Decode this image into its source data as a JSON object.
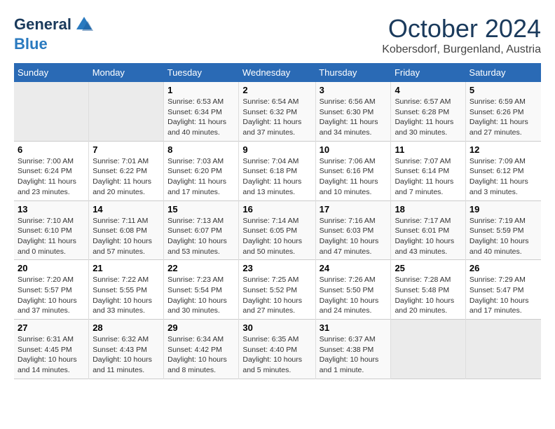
{
  "header": {
    "logo_line1": "General",
    "logo_line2": "Blue",
    "month": "October 2024",
    "location": "Kobersdorf, Burgenland, Austria"
  },
  "weekdays": [
    "Sunday",
    "Monday",
    "Tuesday",
    "Wednesday",
    "Thursday",
    "Friday",
    "Saturday"
  ],
  "weeks": [
    [
      {
        "day": "",
        "info": ""
      },
      {
        "day": "",
        "info": ""
      },
      {
        "day": "1",
        "info": "Sunrise: 6:53 AM\nSunset: 6:34 PM\nDaylight: 11 hours and 40 minutes."
      },
      {
        "day": "2",
        "info": "Sunrise: 6:54 AM\nSunset: 6:32 PM\nDaylight: 11 hours and 37 minutes."
      },
      {
        "day": "3",
        "info": "Sunrise: 6:56 AM\nSunset: 6:30 PM\nDaylight: 11 hours and 34 minutes."
      },
      {
        "day": "4",
        "info": "Sunrise: 6:57 AM\nSunset: 6:28 PM\nDaylight: 11 hours and 30 minutes."
      },
      {
        "day": "5",
        "info": "Sunrise: 6:59 AM\nSunset: 6:26 PM\nDaylight: 11 hours and 27 minutes."
      }
    ],
    [
      {
        "day": "6",
        "info": "Sunrise: 7:00 AM\nSunset: 6:24 PM\nDaylight: 11 hours and 23 minutes."
      },
      {
        "day": "7",
        "info": "Sunrise: 7:01 AM\nSunset: 6:22 PM\nDaylight: 11 hours and 20 minutes."
      },
      {
        "day": "8",
        "info": "Sunrise: 7:03 AM\nSunset: 6:20 PM\nDaylight: 11 hours and 17 minutes."
      },
      {
        "day": "9",
        "info": "Sunrise: 7:04 AM\nSunset: 6:18 PM\nDaylight: 11 hours and 13 minutes."
      },
      {
        "day": "10",
        "info": "Sunrise: 7:06 AM\nSunset: 6:16 PM\nDaylight: 11 hours and 10 minutes."
      },
      {
        "day": "11",
        "info": "Sunrise: 7:07 AM\nSunset: 6:14 PM\nDaylight: 11 hours and 7 minutes."
      },
      {
        "day": "12",
        "info": "Sunrise: 7:09 AM\nSunset: 6:12 PM\nDaylight: 11 hours and 3 minutes."
      }
    ],
    [
      {
        "day": "13",
        "info": "Sunrise: 7:10 AM\nSunset: 6:10 PM\nDaylight: 11 hours and 0 minutes."
      },
      {
        "day": "14",
        "info": "Sunrise: 7:11 AM\nSunset: 6:08 PM\nDaylight: 10 hours and 57 minutes."
      },
      {
        "day": "15",
        "info": "Sunrise: 7:13 AM\nSunset: 6:07 PM\nDaylight: 10 hours and 53 minutes."
      },
      {
        "day": "16",
        "info": "Sunrise: 7:14 AM\nSunset: 6:05 PM\nDaylight: 10 hours and 50 minutes."
      },
      {
        "day": "17",
        "info": "Sunrise: 7:16 AM\nSunset: 6:03 PM\nDaylight: 10 hours and 47 minutes."
      },
      {
        "day": "18",
        "info": "Sunrise: 7:17 AM\nSunset: 6:01 PM\nDaylight: 10 hours and 43 minutes."
      },
      {
        "day": "19",
        "info": "Sunrise: 7:19 AM\nSunset: 5:59 PM\nDaylight: 10 hours and 40 minutes."
      }
    ],
    [
      {
        "day": "20",
        "info": "Sunrise: 7:20 AM\nSunset: 5:57 PM\nDaylight: 10 hours and 37 minutes."
      },
      {
        "day": "21",
        "info": "Sunrise: 7:22 AM\nSunset: 5:55 PM\nDaylight: 10 hours and 33 minutes."
      },
      {
        "day": "22",
        "info": "Sunrise: 7:23 AM\nSunset: 5:54 PM\nDaylight: 10 hours and 30 minutes."
      },
      {
        "day": "23",
        "info": "Sunrise: 7:25 AM\nSunset: 5:52 PM\nDaylight: 10 hours and 27 minutes."
      },
      {
        "day": "24",
        "info": "Sunrise: 7:26 AM\nSunset: 5:50 PM\nDaylight: 10 hours and 24 minutes."
      },
      {
        "day": "25",
        "info": "Sunrise: 7:28 AM\nSunset: 5:48 PM\nDaylight: 10 hours and 20 minutes."
      },
      {
        "day": "26",
        "info": "Sunrise: 7:29 AM\nSunset: 5:47 PM\nDaylight: 10 hours and 17 minutes."
      }
    ],
    [
      {
        "day": "27",
        "info": "Sunrise: 6:31 AM\nSunset: 4:45 PM\nDaylight: 10 hours and 14 minutes."
      },
      {
        "day": "28",
        "info": "Sunrise: 6:32 AM\nSunset: 4:43 PM\nDaylight: 10 hours and 11 minutes."
      },
      {
        "day": "29",
        "info": "Sunrise: 6:34 AM\nSunset: 4:42 PM\nDaylight: 10 hours and 8 minutes."
      },
      {
        "day": "30",
        "info": "Sunrise: 6:35 AM\nSunset: 4:40 PM\nDaylight: 10 hours and 5 minutes."
      },
      {
        "day": "31",
        "info": "Sunrise: 6:37 AM\nSunset: 4:38 PM\nDaylight: 10 hours and 1 minute."
      },
      {
        "day": "",
        "info": ""
      },
      {
        "day": "",
        "info": ""
      }
    ]
  ]
}
